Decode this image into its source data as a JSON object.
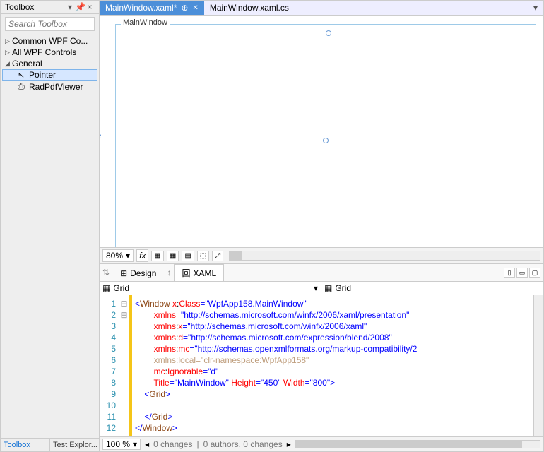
{
  "toolbox": {
    "title": "Toolbox",
    "search_placeholder": "Search Toolbox",
    "nodes": [
      {
        "label": "Common WPF Co...",
        "expanded": false
      },
      {
        "label": "All WPF Controls",
        "expanded": false
      },
      {
        "label": "General",
        "expanded": true
      }
    ],
    "items": [
      {
        "icon": "↖",
        "label": "Pointer",
        "selected": true
      },
      {
        "icon": "⎙",
        "label": "RadPdfViewer",
        "selected": false
      }
    ],
    "bottom_tabs": [
      "Toolbox",
      "Test Explor..."
    ]
  },
  "tabs": {
    "items": [
      {
        "label": "MainWindow.xaml*",
        "active": true
      },
      {
        "label": "MainWindow.xaml.cs",
        "active": false
      }
    ]
  },
  "designer": {
    "window_title": "MainWindow",
    "zoom": "80%"
  },
  "split": {
    "design": "Design",
    "xaml": "XAML"
  },
  "gridbar": {
    "left": "Grid",
    "right": "Grid"
  },
  "code": {
    "lines": [
      "1",
      "2",
      "3",
      "4",
      "5",
      "6",
      "7",
      "8",
      "9",
      "10",
      "11",
      "12"
    ]
  },
  "xaml_tokens": {
    "l1_a": "<",
    "l1_b": "Window",
    "l1_c": " x",
    "l1_d": ":",
    "l1_e": "Class",
    "l1_f": "=\"WpfApp158.MainWindow\"",
    "l2_a": "xmlns",
    "l2_b": "=\"http://schemas.microsoft.com/winfx/2006/xaml/presentation\"",
    "l3_a": "xmlns",
    "l3_b": ":",
    "l3_c": "x",
    "l3_d": "=\"http://schemas.microsoft.com/winfx/2006/xaml\"",
    "l4_a": "xmlns",
    "l4_b": ":",
    "l4_c": "d",
    "l4_d": "=\"http://schemas.microsoft.com/expression/blend/2008\"",
    "l5_a": "xmlns",
    "l5_b": ":",
    "l5_c": "mc",
    "l5_d": "=\"http://schemas.openxmlformats.org/markup-compatibility/2",
    "l6_a": "xmlns",
    "l6_b": ":",
    "l6_c": "local",
    "l6_d": "=\"clr-namespace:WpfApp158\"",
    "l7_a": "mc",
    "l7_b": ":",
    "l7_c": "Ignorable",
    "l7_d": "=\"d\"",
    "l8_a": "Title",
    "l8_b": "=\"MainWindow\"",
    "l8_c": " Height",
    "l8_d": "=\"450\"",
    "l8_e": " Width",
    "l8_f": "=\"800\"",
    "l8_g": ">",
    "l9_a": "<",
    "l9_b": "Grid",
    "l9_c": ">",
    "l11_a": "</",
    "l11_b": "Grid",
    "l11_c": ">",
    "l12_a": "</",
    "l12_b": "Window",
    "l12_c": ">"
  },
  "status": {
    "zoom": "100 %",
    "changes1": "0 changes",
    "changes2": "0 authors, 0 changes"
  }
}
